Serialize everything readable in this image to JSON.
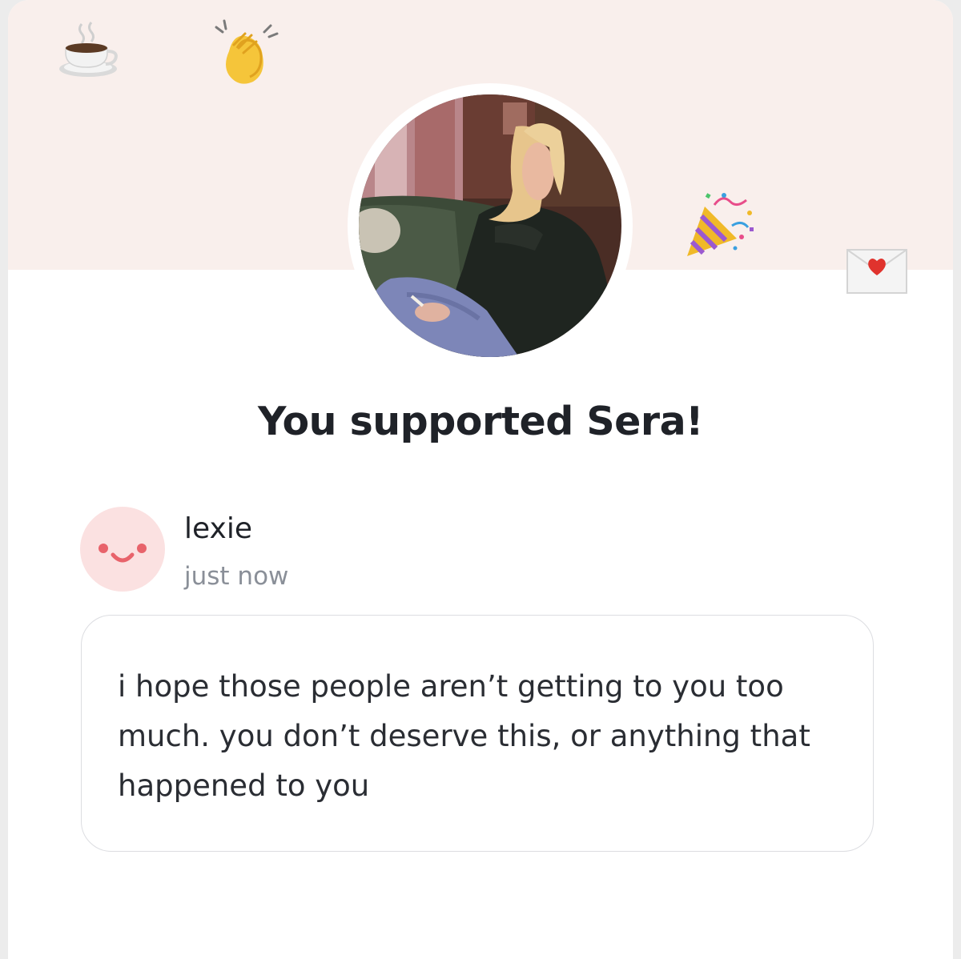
{
  "banner": {
    "background": "#f9efec",
    "icons": [
      "coffee-cup-icon",
      "clapping-hands-icon",
      "party-popper-icon",
      "heart-envelope-icon"
    ]
  },
  "profile": {
    "photo": "creator-profile-photo"
  },
  "headline": "You supported Sera!",
  "supporter": {
    "name": "lexie",
    "time": "just now",
    "avatar_icon": "smiley-face-icon",
    "avatar_color": "#fbe1e1",
    "accent_color": "#e8636b"
  },
  "message": "i hope those people aren’t getting to you too much. you don’t deserve this, or anything that happened to you"
}
